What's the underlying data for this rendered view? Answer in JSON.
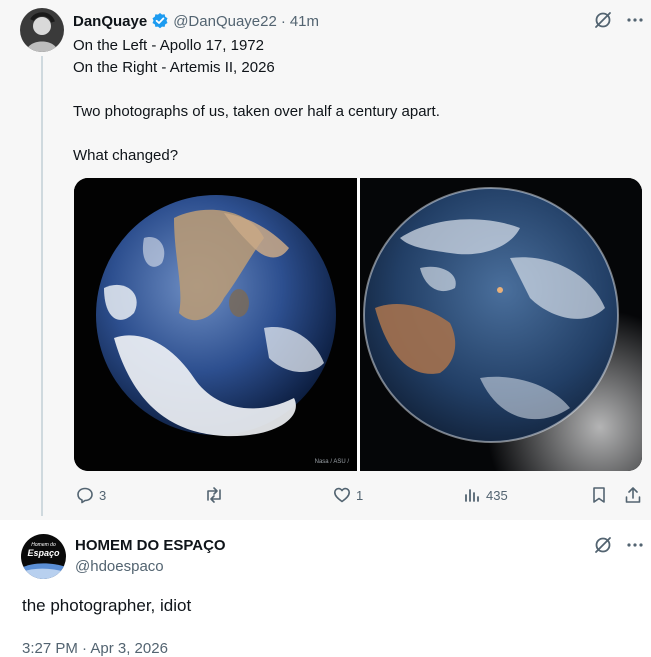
{
  "tweet": {
    "author_name": "DanQuaye",
    "handle": "@DanQuaye22",
    "separator": "·",
    "time": "41m",
    "lines": [
      "On the Left - Apollo 17, 1972",
      "On the Right - Artemis II, 2026"
    ],
    "paragraph": "Two photographs of us, taken over half a century apart.",
    "question": "What changed?",
    "media_credit": "Nasa / ASU /",
    "actions": {
      "replies": "3",
      "reposts": "",
      "likes": "1",
      "views": "435"
    }
  },
  "reply": {
    "author_name": "HOMEM DO ESPAÇO",
    "handle": "@hdoespaco",
    "avatar_text_top": "Homem do",
    "avatar_text_main": "Espaço",
    "text": "the photographer, idiot",
    "timestamp": "3:27 PM · Apr 3, 2026"
  },
  "colors": {
    "verified_blue": "#1d9bf0",
    "muted_text": "#536471",
    "thread_line": "#cfd9de"
  },
  "icons": [
    "verified-badge-icon",
    "grok-icon",
    "more-icon",
    "reply-icon",
    "repost-icon",
    "like-icon",
    "views-icon",
    "bookmark-icon",
    "share-icon"
  ]
}
